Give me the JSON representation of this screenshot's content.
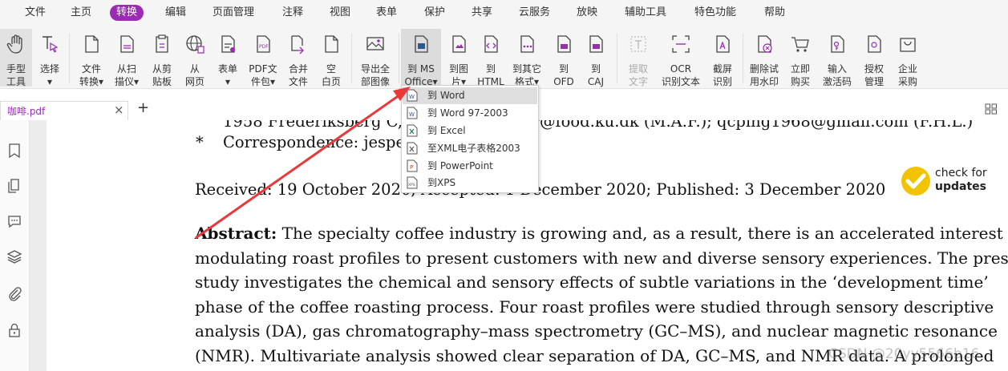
{
  "menu": [
    "文件",
    "主页",
    "转换",
    "编辑",
    "页面管理",
    "注释",
    "视图",
    "表单",
    "保护",
    "共享",
    "云服务",
    "放映",
    "辅助工具",
    "特色功能",
    "帮助"
  ],
  "toolbar": {
    "hand": [
      "手型",
      "工具"
    ],
    "select": [
      "选择",
      "▾"
    ],
    "file_convert": [
      "文件",
      "转换▾"
    ],
    "from_scan": [
      "从扫",
      "描仪▾"
    ],
    "from_clipboard": [
      "从剪",
      "贴板"
    ],
    "from_web": [
      "从",
      "网页"
    ],
    "form": [
      "表单",
      "▾"
    ],
    "pdf_package": [
      "PDF文",
      "件包▾"
    ],
    "merge": [
      "合并",
      "文件"
    ],
    "blank": [
      "空",
      "白页"
    ],
    "export_images": [
      "导出全",
      "部图像"
    ],
    "to_ms_office": [
      "到 MS",
      "Office▾"
    ],
    "to_image": [
      "到图",
      "片▾"
    ],
    "to_html": [
      "到",
      "HTML"
    ],
    "to_other": [
      "到其它",
      "格式▾"
    ],
    "to_ofd": [
      "到",
      "OFD"
    ],
    "to_caj": [
      "到",
      "CAJ"
    ],
    "extract_text": [
      "提取",
      "文字"
    ],
    "ocr": [
      "OCR",
      "识别文本"
    ],
    "screenshot_ocr": [
      "截屏",
      "识别"
    ],
    "remove_watermark": [
      "删除试",
      "用水印"
    ],
    "buy_now": [
      "立即",
      "购买"
    ],
    "activation": [
      "输入",
      "激活码"
    ],
    "license": [
      "授权",
      "管理"
    ],
    "enterprise": [
      "企业",
      "采购"
    ]
  },
  "tab": {
    "name": "咖啡.pdf",
    "close": "×",
    "new": "+"
  },
  "dropdown": [
    "到 Word",
    "到 Word 97-2003",
    "到 Excel",
    "至XML电子表格2003",
    "到 PowerPoint",
    "到XPS"
  ],
  "document": {
    "line_affil": "1958 Frederiksberg C, Denmark; jesper@food.ku.dk (M.A.F.); qcping1968@gmail.com (F.H.L.)",
    "star": "*",
    "correspondence": "Correspondence: jesper@food.ku.dk",
    "received": "Received: 19 October 2020; Accepted: 1 December 2020; Published: 3 December 2020",
    "abstract_label": "Abstract:",
    "abstract_lines": [
      " The specialty coffee industry is growing and, as a result, there is an accelerated interest in",
      "modulating roast profiles to present customers with new and diverse sensory experiences. The present",
      "study investigates the chemical and sensory effects of subtle variations in the ‘development time’",
      "phase of the coffee roasting process. Four roast profiles were studied through sensory descriptive",
      "analysis (DA), gas chromatography–mass spectrometry (GC–MS), and nuclear magnetic resonance",
      "(NMR). Multivariate analysis showed clear separation of DA, GC–MS, and NMR data. A prolonged"
    ],
    "check_updates": [
      "check for",
      "updates"
    ],
    "watermark": "CSDN @20yy5566b16"
  },
  "colors": {
    "accent": "#9b2bb3",
    "arrow": "#e8393b",
    "badge": "#f2c300"
  }
}
